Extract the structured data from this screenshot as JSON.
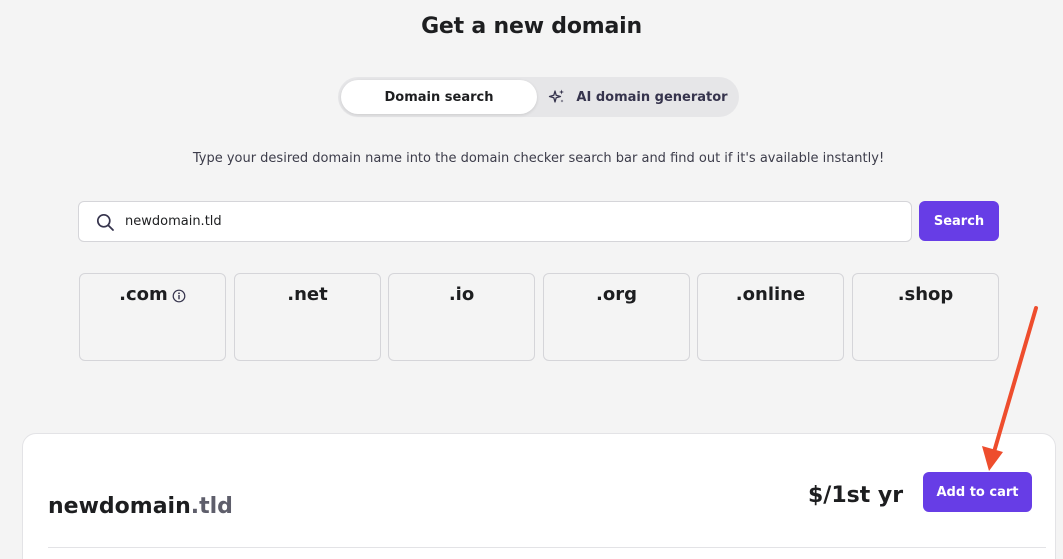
{
  "page": {
    "title": "Get a new domain",
    "subtitle": "Type your desired domain name into the domain checker search bar and find out if it's available instantly!"
  },
  "toggle": {
    "tabs": [
      {
        "label": "Domain search",
        "active": true
      },
      {
        "label": "AI domain generator",
        "active": false,
        "icon": "sparkle-icon"
      }
    ]
  },
  "search": {
    "value": "newdomain.tld",
    "placeholder": "",
    "button_label": "Search",
    "icon": "search-icon"
  },
  "tlds": [
    {
      "name": ".com",
      "has_info": true
    },
    {
      "name": ".net",
      "has_info": false
    },
    {
      "name": ".io",
      "has_info": false
    },
    {
      "name": ".org",
      "has_info": false
    },
    {
      "name": ".online",
      "has_info": false
    },
    {
      "name": ".shop",
      "has_info": false
    }
  ],
  "result": {
    "domain_name": "newdomain",
    "domain_tld": ".tld",
    "price": "$/1st yr",
    "add_to_cart_label": "Add to cart"
  },
  "colors": {
    "accent": "#673de6",
    "annotation_arrow": "#ee4d2d",
    "background": "#f4f4f4"
  }
}
